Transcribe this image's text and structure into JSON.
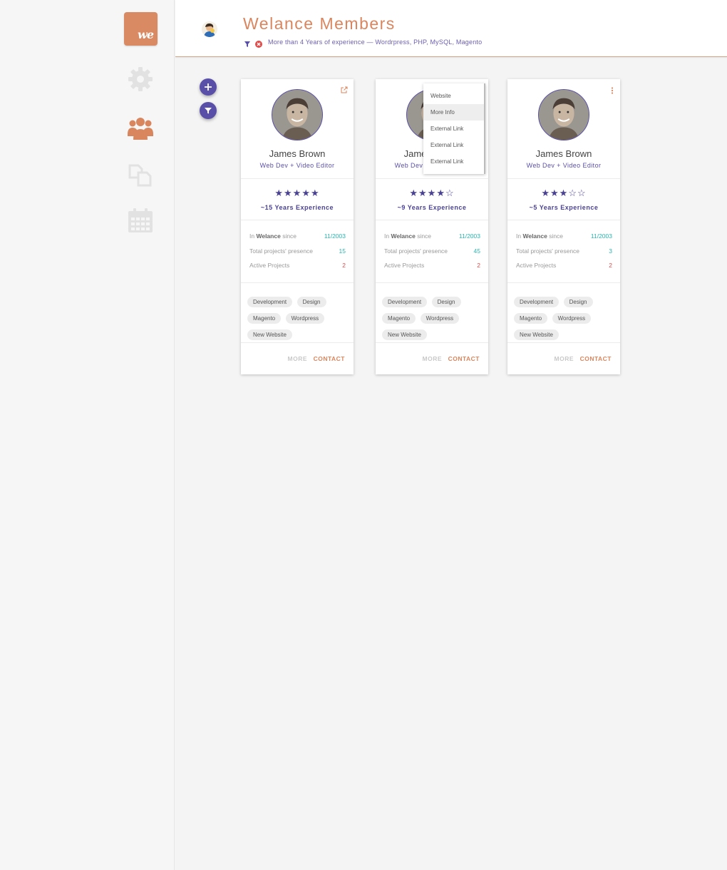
{
  "app": {
    "logo_text": "we",
    "title": "Welance Members",
    "filter_text": "More than 4 Years of experience — Wordrpress, PHP, MySQL, Magento"
  },
  "sidebar": {
    "items": [
      {
        "icon": "gear-icon"
      },
      {
        "icon": "users-icon"
      },
      {
        "icon": "documents-icon"
      },
      {
        "icon": "calendar-icon"
      }
    ]
  },
  "colors": {
    "accent": "#d9865e",
    "primary": "#5a4fa8",
    "teal": "#2bb5b0",
    "red": "#e04a48"
  },
  "members": [
    {
      "name": "James Brown",
      "role": "Web Dev + Video Editor",
      "stars": "★★★★★",
      "rating": 5,
      "experience": "~15 Years Experience",
      "since_label_pre": "In",
      "since_label_bold": "Welance",
      "since_label_post": "since",
      "since_value": "11/2003",
      "presence_label": "Total projects' presence",
      "presence_value": "15",
      "active_label": "Active Projects",
      "active_value": "2",
      "tags": [
        "Development",
        "Design",
        "Magento",
        "Wordpress",
        "New Website"
      ],
      "more": "MORE",
      "contact": "CONTACT"
    },
    {
      "name": "James Brown",
      "role": "Web Dev + Video Editor",
      "stars": "★★★★☆",
      "rating": 4,
      "experience": "~9 Years Experience",
      "since_label_pre": "In",
      "since_label_bold": "Welance",
      "since_label_post": "since",
      "since_value": "11/2003",
      "presence_label": "Total projects' presence",
      "presence_value": "45",
      "active_label": "Active Projects",
      "active_value": "2",
      "tags": [
        "Development",
        "Design",
        "Magento",
        "Wordpress",
        "New Website"
      ],
      "more": "MORE",
      "contact": "CONTACT"
    },
    {
      "name": "James Brown",
      "role": "Web Dev + Video Editor",
      "stars": "★★★☆☆",
      "rating": 3,
      "experience": "~5 Years Experience",
      "since_label_pre": "In",
      "since_label_bold": "Welance",
      "since_label_post": "since",
      "since_value": "11/2003",
      "presence_label": "Total projects' presence",
      "presence_value": "3",
      "active_label": "Active Projects",
      "active_value": "2",
      "tags": [
        "Development",
        "Design",
        "Magento",
        "Wordpress",
        "New Website"
      ],
      "more": "MORE",
      "contact": "CONTACT"
    }
  ],
  "dropdown": {
    "items": [
      "Website",
      "More Info",
      "External Link",
      "External Link",
      "External Link"
    ],
    "highlighted": "More Info"
  }
}
